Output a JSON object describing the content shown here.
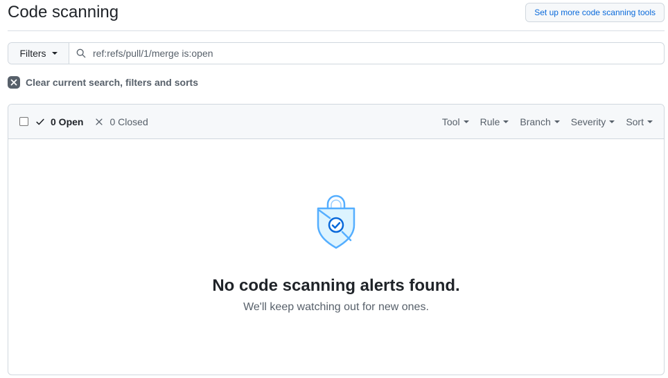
{
  "header": {
    "title": "Code scanning",
    "setup_button": "Set up more code scanning tools"
  },
  "filter_bar": {
    "filters_label": "Filters",
    "search_value": "ref:refs/pull/1/merge is:open"
  },
  "clear": {
    "label": "Clear current search, filters and sorts"
  },
  "results": {
    "open_label": "0 Open",
    "closed_label": "0 Closed",
    "filters": [
      "Tool",
      "Rule",
      "Branch",
      "Severity",
      "Sort"
    ]
  },
  "empty_state": {
    "title": "No code scanning alerts found.",
    "subtitle": "We'll keep watching out for new ones."
  },
  "colors": {
    "accent": "#0969da",
    "icon_blue": "#54aeff"
  },
  "icons": {
    "search": "search-icon",
    "clear": "x-circle-icon",
    "open": "check-icon",
    "closed": "x-icon",
    "empty": "shield-check-icon"
  }
}
